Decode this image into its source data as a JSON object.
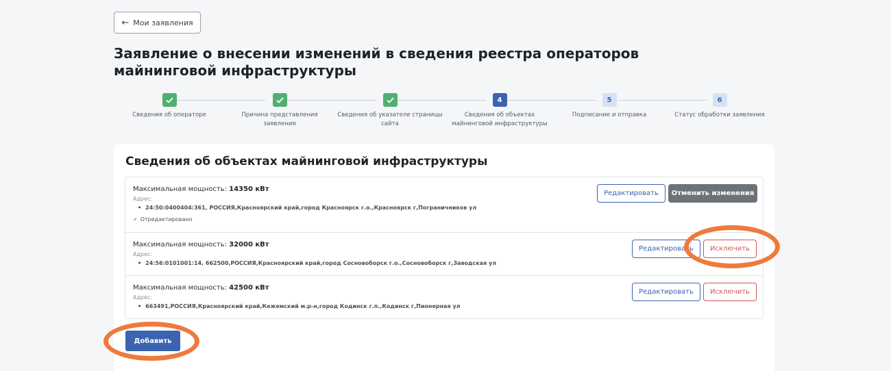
{
  "back_button": {
    "arrow": "←",
    "label": "Мои заявления"
  },
  "page_title": "Заявление о внесении изменений в сведения реестра операторов майнинговой инфраструктуры",
  "steps": [
    {
      "label": "Сведения об операторе",
      "state": "done",
      "num": ""
    },
    {
      "label": "Причина представления заявления",
      "state": "done",
      "num": ""
    },
    {
      "label": "Сведения об указателе страницы сайта",
      "state": "done",
      "num": ""
    },
    {
      "label": "Сведения об объектах майнинговой инфраструктуры",
      "state": "active",
      "num": "4"
    },
    {
      "label": "Подписание и отправка",
      "state": "todo",
      "num": "5"
    },
    {
      "label": "Статус обработки заявления",
      "state": "todo",
      "num": "6"
    }
  ],
  "section": {
    "title": "Сведения об объектах майнинговой инфраструктуры",
    "power_label": "Максимальная мощность:",
    "address_label": "Адрес:",
    "items": [
      {
        "power": "14350 кВт",
        "address": "24:50:0400404:361, РОССИЯ,Красноярский край,город Красноярск г.о.,Красноярск г,Пограничников ул",
        "edited_mark": "✓",
        "edited": "Отредактировано",
        "edit_label": "Редактировать",
        "secondary_label": "Отменить изменения"
      },
      {
        "power": "32000 кВт",
        "address": "24:56:0101001:14, 662500,РОССИЯ,Красноярский край,город Сосновоборск г.о.,Сосновоборск г,Заводская ул",
        "edit_label": "Редактировать",
        "secondary_label": "Исключить"
      },
      {
        "power": "42500 кВт",
        "address": "663491,РОССИЯ,Красноярский край,Кежемский м.р-н,город Кодинск г.п.,Кодинск г,Пионерная ул",
        "edit_label": "Редактировать",
        "secondary_label": "Исключить"
      }
    ]
  },
  "add_button": "Добавить",
  "colors": {
    "primary": "#3b63b0",
    "success": "#4fb06f",
    "danger": "#d9534f",
    "muted_button": "#6c7278",
    "highlight": "#ee7a3c"
  }
}
